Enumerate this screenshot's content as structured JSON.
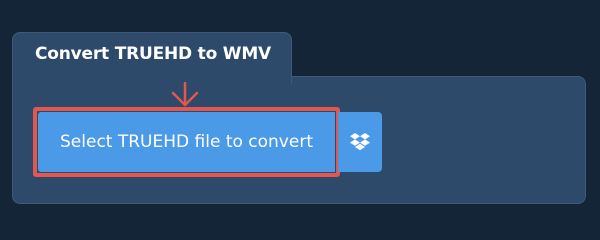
{
  "tab": {
    "title": "Convert TRUEHD to WMV"
  },
  "upload": {
    "select_label": "Select TRUEHD file to convert",
    "dropbox_icon": "dropbox-icon",
    "arrow_icon": "arrow-down-icon"
  },
  "colors": {
    "background": "#152538",
    "panel": "#2e4a6b",
    "button": "#4a9ae8",
    "highlight": "#e2574f",
    "text": "#ffffff"
  }
}
